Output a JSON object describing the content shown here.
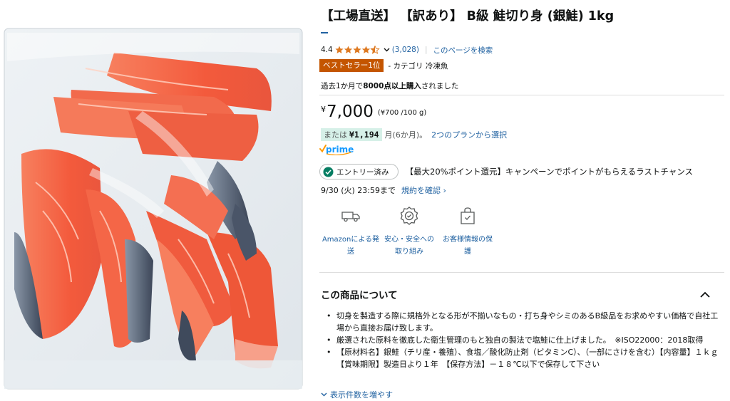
{
  "product": {
    "title": "【工場直送】 【訳あり】 B級 鮭切り身 (銀鮭) 1kg",
    "image_alt": "銀鮭切り身 1kg 袋詰め"
  },
  "rating": {
    "value": "4.4",
    "stars": 4.4,
    "count": "(3,028)",
    "search_link": "このページを検索"
  },
  "badge": {
    "label": "ベストセラー1位",
    "category": "- カテゴリ 冷凍魚"
  },
  "bought": {
    "prefix": "過去1か月で",
    "bold": "8000点以上購入",
    "suffix": "されました"
  },
  "price": {
    "symbol": "¥",
    "whole": "7,000",
    "unit_price": "(¥700 /100 g)"
  },
  "installment": {
    "or": "または",
    "amount": "¥1,194",
    "term": "月(6か月)。",
    "plans_link": "2つのプランから選択"
  },
  "prime": {
    "label": "prime"
  },
  "campaign": {
    "entry_label": "エントリー済み",
    "text": "【最大20%ポイント還元】キャンペーンでポイントがもらえるラストチャンス",
    "deadline": "9/30 (火) 23:59まで",
    "terms_link": "規約を確認 ›"
  },
  "features": [
    {
      "icon": "delivery-truck-icon",
      "line1": "Amazonによる発",
      "line2": "送"
    },
    {
      "icon": "safety-badge-icon",
      "line1": "安心・安全への",
      "line2": "取り組み"
    },
    {
      "icon": "secure-bag-icon",
      "line1": "お客様情報の保",
      "line2": "護"
    }
  ],
  "about": {
    "title": "この商品について",
    "bullets": [
      "切身を製造する際に規格外となる形が不揃いなもの・打ち身やシミのあるB級品をお求めやすい価格で自社工場から直接お届け致します。",
      "厳選された原料を徹底した衛生管理のもと独自の製法で塩鮭に仕上げました。　※ISO22000：2018取得",
      "【原材料名】銀鮭（チリ産・養殖）、食塩／酸化防止剤（ビタミンC）、（一部にさけを含む）【内容量】１ｋｇ　【賞味期限】製造日より１年　【保存方法】－１８℃以下で保存して下さい"
    ],
    "show_more": "表示件数を増やす"
  },
  "colors": {
    "link": "#2162a1",
    "badge": "#c45500",
    "star": "#de7921",
    "highlight": "#d6f0e8",
    "prime": "#1399ff"
  }
}
